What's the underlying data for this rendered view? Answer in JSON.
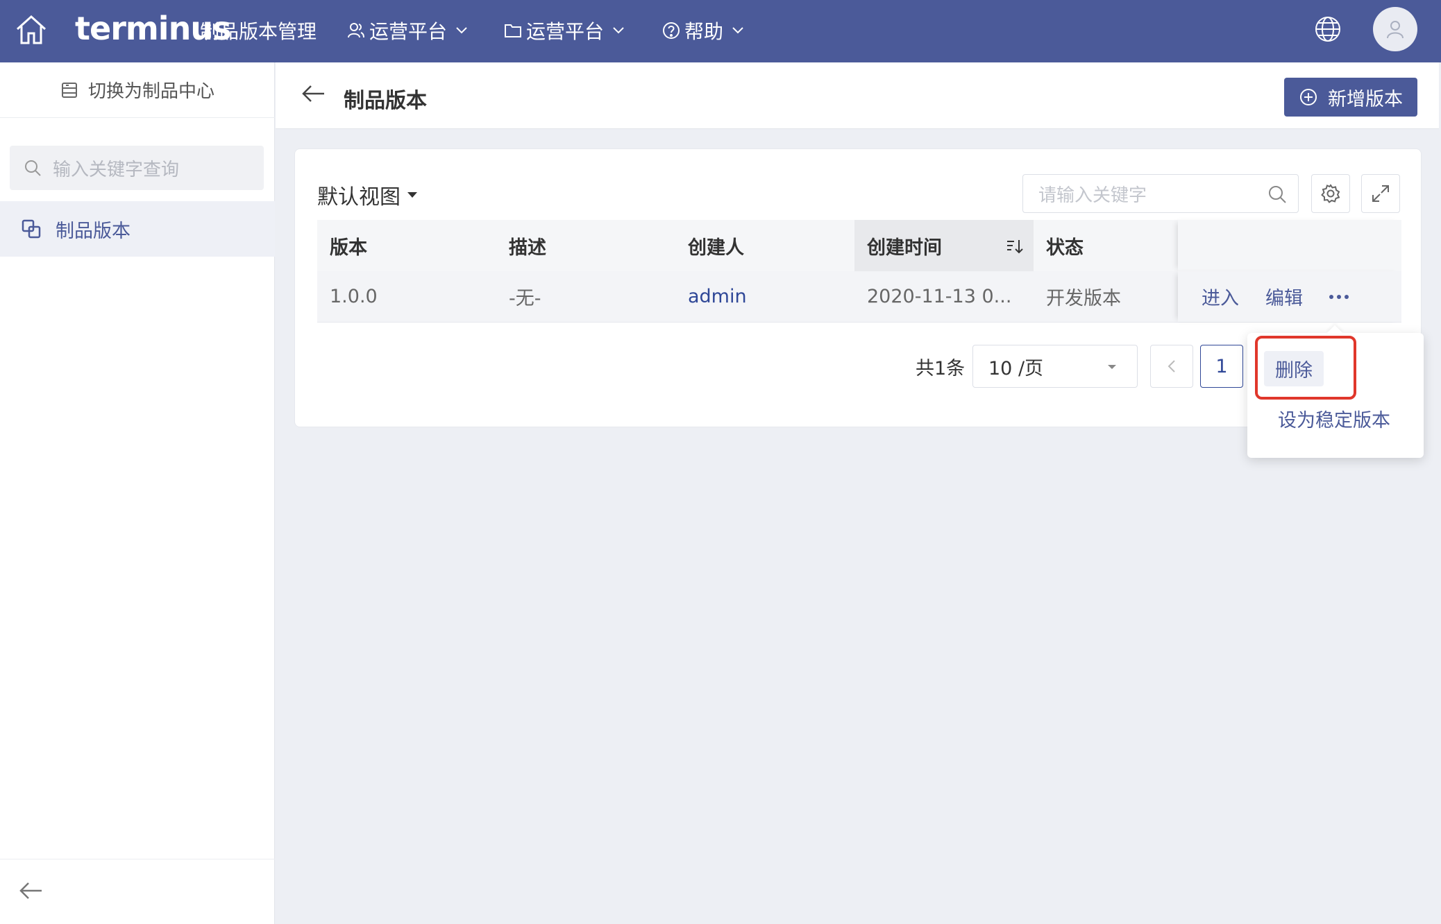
{
  "header": {
    "logo": "terminus",
    "app_name": "制品版本管理",
    "nav": [
      {
        "label": "运营平台",
        "icon": "user-icon"
      },
      {
        "label": "运营平台",
        "icon": "folder-icon"
      },
      {
        "label": "帮助",
        "icon": "help-icon"
      }
    ]
  },
  "sidebar": {
    "switch_label": "切换为制品中心",
    "search_placeholder": "输入关键字查询",
    "items": [
      {
        "label": "制品版本",
        "active": true
      }
    ]
  },
  "page": {
    "title": "制品版本",
    "add_button": "新增版本"
  },
  "card": {
    "view_label": "默认视图",
    "search_placeholder": "请输入关键字"
  },
  "table": {
    "columns": [
      "版本",
      "描述",
      "创建人",
      "创建时间",
      "状态",
      ""
    ],
    "rows": [
      {
        "version": "1.0.0",
        "desc": "-无-",
        "creator": "admin",
        "created": "2020-11-13 0...",
        "status": "开发版本",
        "actions": [
          "进入",
          "编辑"
        ]
      }
    ]
  },
  "pagination": {
    "total": "共1条",
    "page_size": "10 /页",
    "current_page": "1"
  },
  "dropdown": {
    "items": [
      "删除",
      "设为稳定版本"
    ]
  },
  "colors": {
    "primary": "#4b5a99",
    "highlight": "#e0372b"
  }
}
